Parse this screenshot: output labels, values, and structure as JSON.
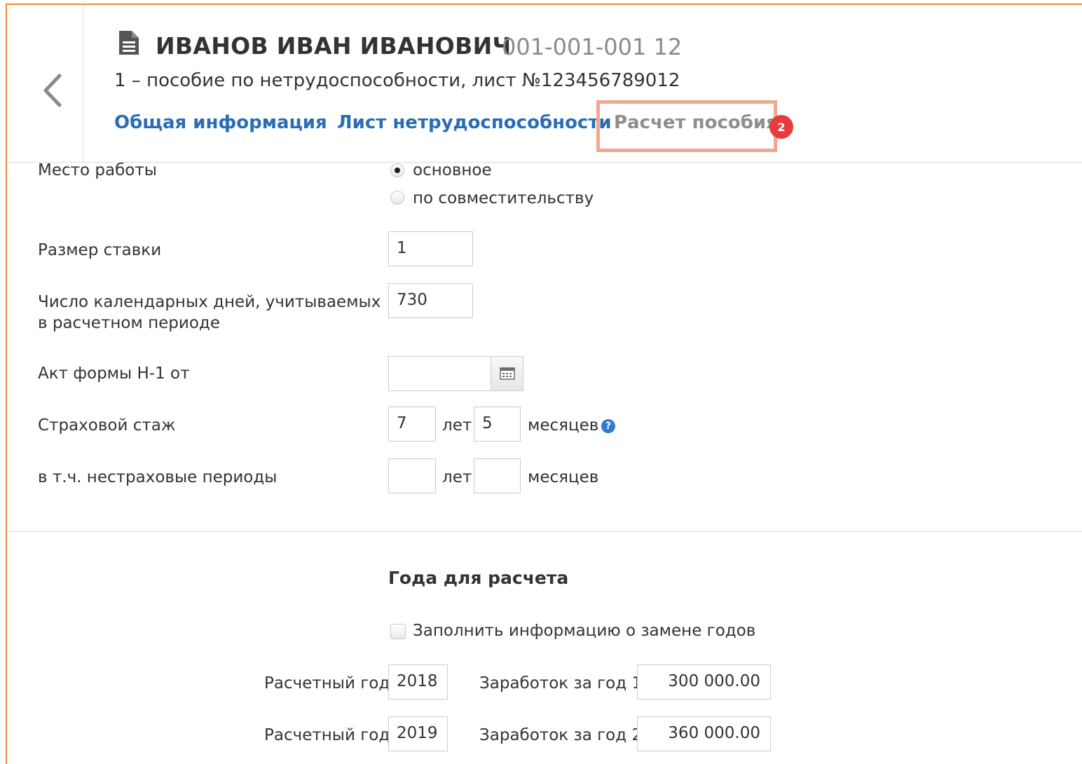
{
  "header": {
    "name": "ИВАНОВ ИВАН ИВАНОВИЧ",
    "code": "001-001-001 12",
    "subtitle": "1 – пособие по нетрудоспособности, лист №123456789012"
  },
  "tabs": [
    {
      "label": "Общая информация"
    },
    {
      "label": "Лист нетрудоспособности"
    },
    {
      "label": "Расчет пособия",
      "badge": "2",
      "active": true
    }
  ],
  "form": {
    "workplace": {
      "label": "Место работы",
      "options": [
        {
          "label": "основное",
          "selected": true
        },
        {
          "label": "по совместительству",
          "selected": false
        }
      ]
    },
    "rate": {
      "label": "Размер ставки",
      "value": "1"
    },
    "calendar_days": {
      "label_line1": "Число календарных дней, учитываемых",
      "label_line2": "в расчетном периоде",
      "value": "730"
    },
    "act": {
      "label": "Акт формы Н-1 от",
      "value": ""
    },
    "insurance": {
      "label": "Страховой стаж",
      "years": "7",
      "years_unit": "лет",
      "months": "5",
      "months_unit": "месяцев"
    },
    "non_insurance": {
      "label": "в т.ч. нестраховые периоды",
      "years": "",
      "years_unit": "лет",
      "months": "",
      "months_unit": "месяцев"
    }
  },
  "years_section": {
    "title": "Года для расчета",
    "replace_checkbox": {
      "label": "Заполнить информацию о замене годов",
      "checked": false
    },
    "rows": [
      {
        "year_label": "Расчетный год",
        "year": "2018",
        "earn_label": "Заработок за год 1",
        "earn": "300 000.00"
      },
      {
        "year_label": "Расчетный год",
        "year": "2019",
        "earn_label": "Заработок за год 2",
        "earn": "360 000.00"
      }
    ]
  },
  "colors": {
    "accent_border": "#ed8a3d",
    "link": "#2a6db5",
    "highlight": "#f3a793",
    "badge": "#e83b3b"
  }
}
